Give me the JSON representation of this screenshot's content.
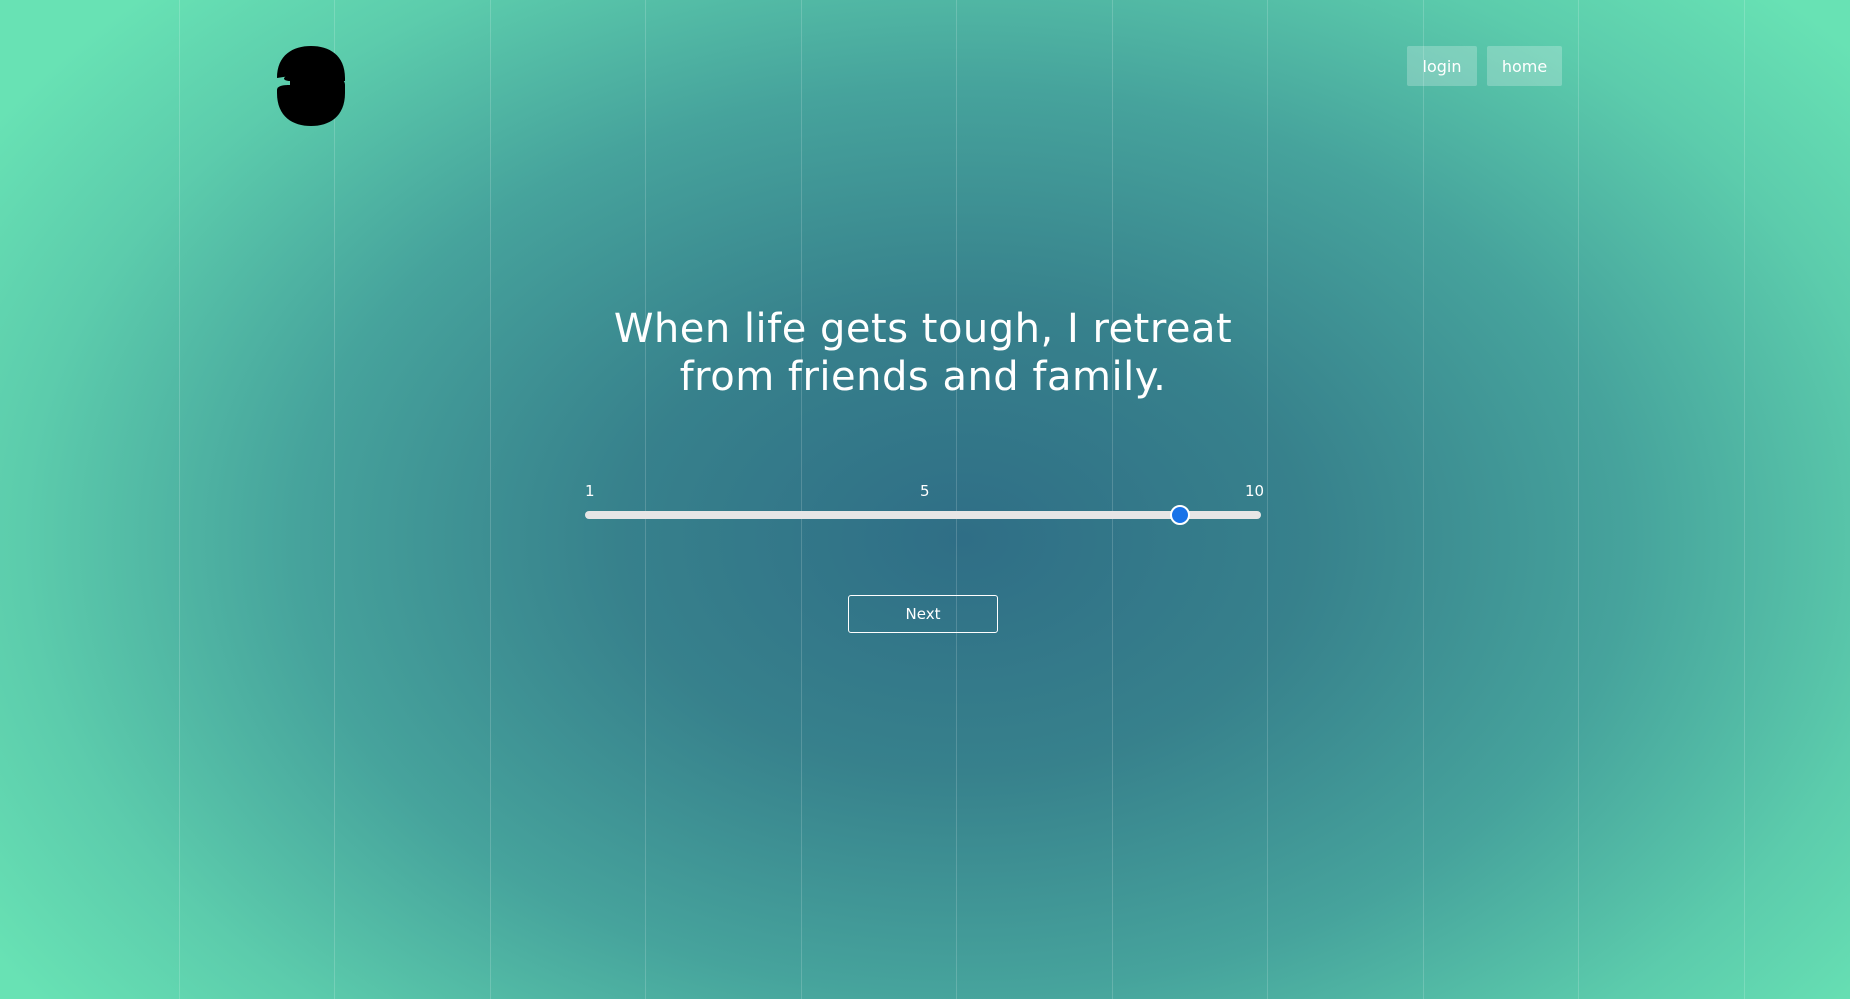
{
  "header": {
    "logo_icon": "s-logo-icon",
    "nav": {
      "login_label": "login",
      "home_label": "home"
    }
  },
  "question": {
    "text": "When life gets tough, I retreat from friends and family."
  },
  "scale": {
    "min_label": "1",
    "mid_label": "5",
    "max_label": "10",
    "min": 1,
    "max": 10,
    "value": 8.9,
    "thumb_color": "#1a73e8",
    "track_color": "#e6e6e6"
  },
  "actions": {
    "next_label": "Next"
  },
  "colors": {
    "background_center": "#2f6e86",
    "background_edge": "#68e2b4"
  }
}
